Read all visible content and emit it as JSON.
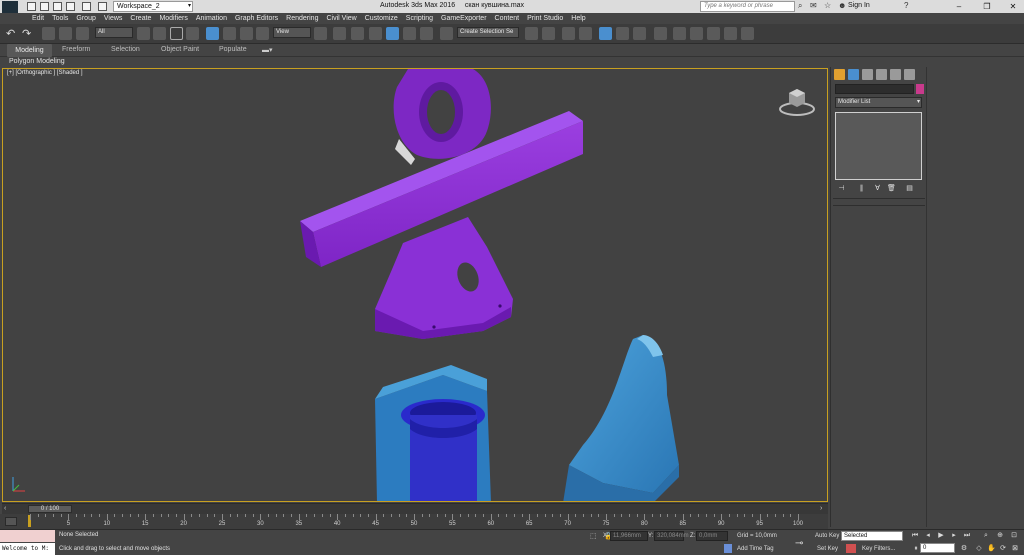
{
  "titlebar": {
    "workspace": "Workspace_2",
    "app_title": "Autodesk 3ds Max 2016     скан кувшина.max",
    "search_placeholder": "Type a keyword or phrase",
    "signin": "Sign In",
    "logo_text": "MAX",
    "minimize": "–",
    "restore": "❐",
    "close": "✕"
  },
  "menu": [
    "Edit",
    "Tools",
    "Group",
    "Views",
    "Create",
    "Modifiers",
    "Animation",
    "Graph Editors",
    "Rendering",
    "Civil View",
    "Customize",
    "Scripting",
    "GameExporter",
    "Content",
    "Print Studio",
    "Help"
  ],
  "toolbar": {
    "selection_filter": "All",
    "ref_coord": "View",
    "named_selection": "Create Selection Se"
  },
  "ribbon": {
    "tabs": [
      "Modeling",
      "Freeform",
      "Selection",
      "Object Paint",
      "Populate"
    ],
    "panel_label": "Polygon Modeling"
  },
  "viewport": {
    "label": "[+] [Orthographic ] [Shaded ]"
  },
  "command_panel": {
    "modifier_list": "Modifier List",
    "object_color": "#c93a8c"
  },
  "timeline": {
    "position": "0 / 100",
    "ticks": [
      "5",
      "10",
      "15",
      "20",
      "25",
      "30",
      "35",
      "40",
      "45",
      "50",
      "55",
      "60",
      "65",
      "70",
      "75",
      "80",
      "85",
      "90",
      "95",
      "100"
    ]
  },
  "status": {
    "maxscript": "Welcome to M:",
    "selection": "None Selected",
    "prompt": "Click and drag to select and move objects",
    "x_label": "X:",
    "x_value": "11,966mm",
    "y_label": "Y:",
    "y_value": "320,084mm",
    "z_label": "Z:",
    "z_value": "0,0mm",
    "grid": "Grid = 10,0mm",
    "add_time_tag": "Add Time Tag",
    "auto_key": "Auto Key",
    "set_key": "Set Key",
    "key_mode": "Selected",
    "key_filters": "Key Filters...",
    "frame": "0"
  }
}
